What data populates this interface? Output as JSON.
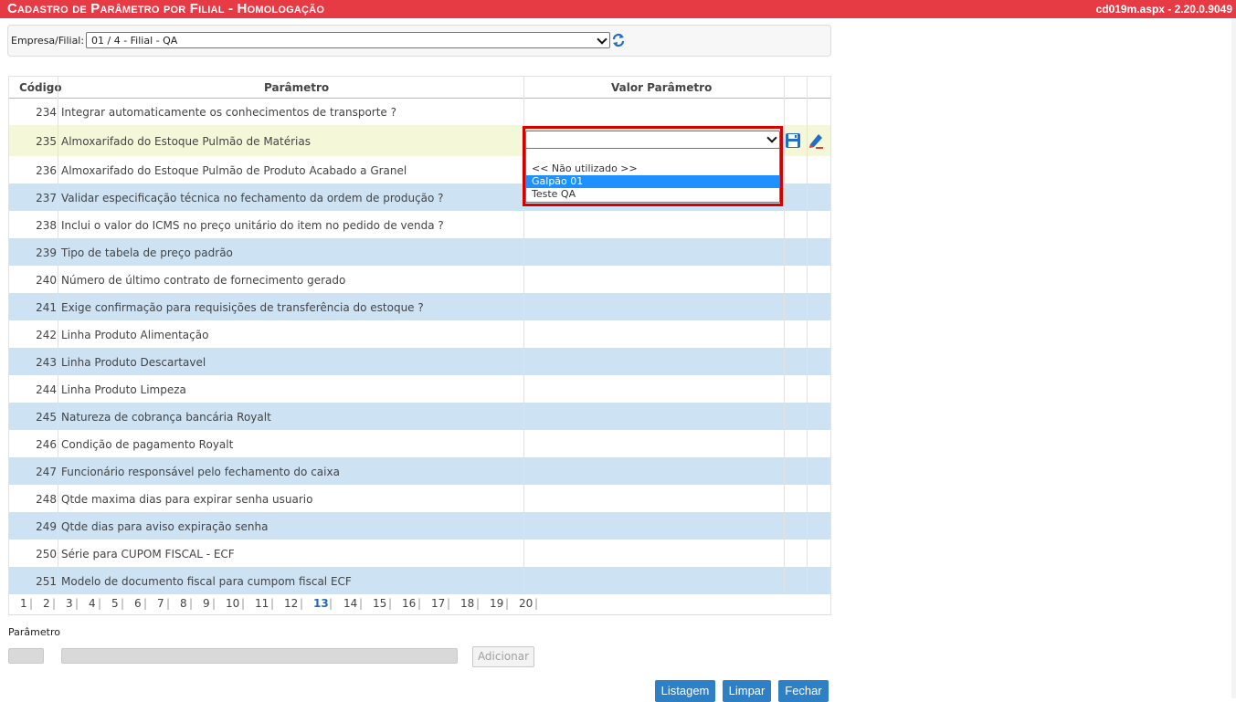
{
  "header": {
    "title": "Cadastro de Parâmetro por Filial  - Homologação",
    "version": "cd019m.aspx - 2.20.0.9049"
  },
  "filter": {
    "label": "Empresa/Filial:",
    "value": "01 / 4 - Filial - QA",
    "refresh_icon": "refresh-icon"
  },
  "grid": {
    "columns": [
      "Código",
      "Parâmetro",
      "Valor Parâmetro"
    ],
    "rows": [
      {
        "code": "234",
        "name": "Integrar automaticamente os conhecimentos de transporte ?"
      },
      {
        "code": "235",
        "name": "Almoxarifado do Estoque Pulmão de Matérias"
      },
      {
        "code": "236",
        "name": "Almoxarifado do Estoque Pulmão de Produto Acabado a Granel"
      },
      {
        "code": "237",
        "name": "Validar especificação técnica no fechamento da ordem de produção ?"
      },
      {
        "code": "238",
        "name": "Inclui o valor do ICMS no preço unitário do item no pedido de venda ?"
      },
      {
        "code": "239",
        "name": "Tipo de tabela de preço padrão"
      },
      {
        "code": "240",
        "name": "Número de último contrato de fornecimento gerado"
      },
      {
        "code": "241",
        "name": "Exige confirmação para requisições de transferência do estoque ?"
      },
      {
        "code": "242",
        "name": "Linha Produto Alimentação"
      },
      {
        "code": "243",
        "name": "Linha Produto Descartavel"
      },
      {
        "code": "244",
        "name": "Linha Produto Limpeza"
      },
      {
        "code": "245",
        "name": "Natureza de cobrança bancária Royalt"
      },
      {
        "code": "246",
        "name": "Condição de pagamento Royalt"
      },
      {
        "code": "247",
        "name": "Funcionário responsável pelo fechamento do caixa"
      },
      {
        "code": "248",
        "name": "Qtde maxima dias para expirar senha usuario"
      },
      {
        "code": "249",
        "name": "Qtde dias para aviso expiração senha"
      },
      {
        "code": "250",
        "name": "Série para CUPOM FISCAL - ECF"
      },
      {
        "code": "251",
        "name": "Modelo de documento fiscal para cumpom fiscal ECF"
      }
    ],
    "editing_row": "235",
    "edit_select_value": "",
    "dropdown_options": [
      "",
      "<< Não utilizado >>",
      "Galpão 01",
      "Teste QA"
    ],
    "dropdown_highlighted": "Galpão 01",
    "row_icons": [
      "save-icon",
      "edit-icon"
    ],
    "pager": [
      "1",
      "2",
      "3",
      "4",
      "5",
      "6",
      "7",
      "8",
      "9",
      "10",
      "11",
      "12",
      "13",
      "14",
      "15",
      "16",
      "17",
      "18",
      "19",
      "20"
    ],
    "current_page": "13"
  },
  "form": {
    "label": "Parâmetro",
    "add_label": "Adicionar"
  },
  "buttons": {
    "list": "Listagem",
    "clear": "Limpar",
    "close": "Fechar"
  },
  "colors": {
    "titlebar": "#e63a45",
    "row_alt": "#cde2f3",
    "row_selected": "#f5f7d9",
    "highlight": "#1e90ff",
    "button": "#2e7fc4",
    "red_frame": "#d40000"
  }
}
